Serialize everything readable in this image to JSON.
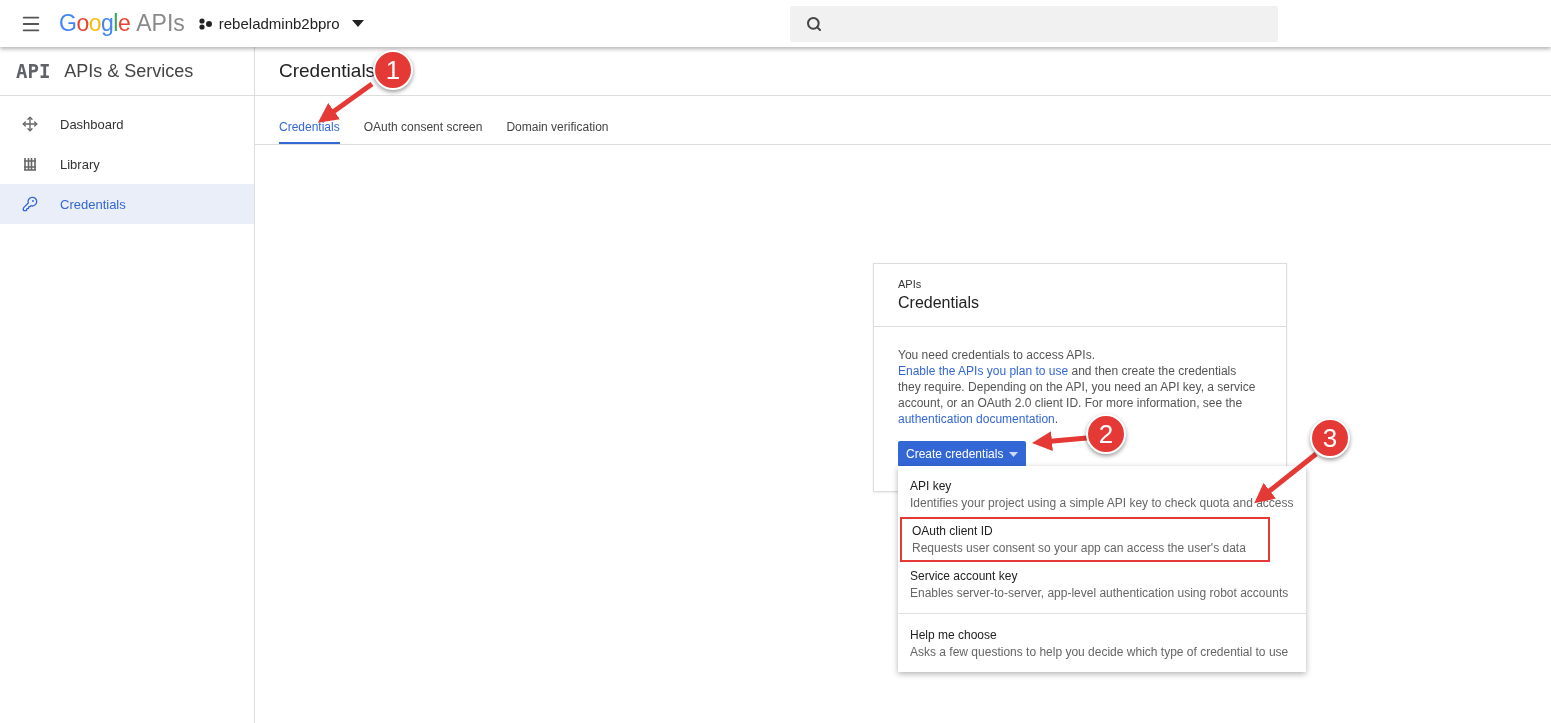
{
  "app_bar": {
    "brand": "Google",
    "brand_suffix": "APIs",
    "project": "rebeladminb2bpro"
  },
  "sidebar": {
    "logo": "API",
    "title": "APIs & Services",
    "items": [
      {
        "label": "Dashboard",
        "selected": false
      },
      {
        "label": "Library",
        "selected": false
      },
      {
        "label": "Credentials",
        "selected": true
      }
    ]
  },
  "page": {
    "title": "Credentials",
    "tabs": [
      {
        "label": "Credentials",
        "selected": true
      },
      {
        "label": "OAuth consent screen",
        "selected": false
      },
      {
        "label": "Domain verification",
        "selected": false
      }
    ]
  },
  "card": {
    "eyebrow": "APIs",
    "title": "Credentials",
    "paragraph": [
      {
        "kind": "text",
        "text": "You need credentials to access APIs. "
      },
      {
        "kind": "link",
        "text": "Enable the APIs you plan to use"
      },
      {
        "kind": "text",
        "text": " and then create the credentials they require. Depending on the API, you need an API key, a service account, or an OAuth 2.0 client ID. For more information, see the "
      },
      {
        "kind": "link",
        "text": "authentication documentation"
      },
      {
        "kind": "text",
        "text": "."
      }
    ],
    "button": "Create credentials",
    "menu": [
      {
        "title": "API key",
        "description": "Identifies your project using a simple API key to check quota and access",
        "highlighted": false,
        "separated": false
      },
      {
        "title": "OAuth client ID",
        "description": "Requests user consent so your app can access the user's data",
        "highlighted": true,
        "separated": false
      },
      {
        "title": "Service account key",
        "description": "Enables server-to-server, app-level authentication using robot accounts",
        "highlighted": false,
        "separated": false
      },
      {
        "title": "Help me choose",
        "description": "Asks a few questions to help you decide which type of credential to use",
        "highlighted": false,
        "separated": true
      }
    ]
  },
  "annotations": [
    {
      "number": "1"
    },
    {
      "number": "2"
    },
    {
      "number": "3"
    }
  ]
}
